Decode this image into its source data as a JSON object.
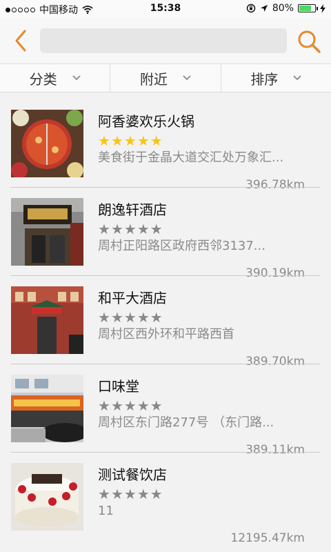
{
  "status_bar": {
    "carrier": "中国移动",
    "time": "15:38",
    "battery_percent": "80%",
    "signal_bars_filled": 1,
    "battery_level": 0.8,
    "battery_color": "#4cd964"
  },
  "header": {
    "back_icon": "chevron-left-icon",
    "search_placeholder": "",
    "search_icon": "search-icon",
    "accent_color": "#e6882b"
  },
  "filters": [
    {
      "label": "分类"
    },
    {
      "label": "附近"
    },
    {
      "label": "排序"
    }
  ],
  "restaurants": [
    {
      "name": "阿香婆欢乐火锅",
      "rating": 5,
      "address": "美食街于金晶大道交汇处万象汇...",
      "distance": "396.78km"
    },
    {
      "name": "朗逸轩酒店",
      "rating": 0,
      "address": "周村正阳路区政府西邻3137...",
      "distance": "390.19km"
    },
    {
      "name": "和平大酒店",
      "rating": 0,
      "address": "周村区西外环和平路西首",
      "distance": "389.70km"
    },
    {
      "name": "口味堂",
      "rating": 0,
      "address": "周村区东门路277号 （东门路...",
      "distance": "389.11km"
    },
    {
      "name": "测试餐饮店",
      "rating": 0,
      "address": "11",
      "distance": "12195.47km"
    }
  ]
}
